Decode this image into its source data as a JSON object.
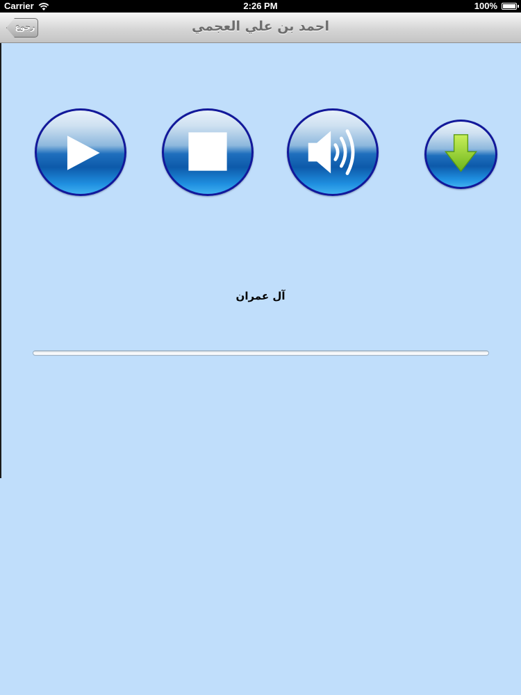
{
  "status_bar": {
    "carrier": "Carrier",
    "time": "2:26 PM",
    "battery": "100%",
    "battery_level": 1.0
  },
  "nav": {
    "back_label": "رجوع",
    "title": "احمد بن علي العجمي"
  },
  "controls": {
    "play": "play-icon",
    "stop": "stop-icon",
    "volume": "speaker-icon",
    "download": "download-arrow-icon"
  },
  "player": {
    "surah_name": "آل عمران",
    "progress": 0.0
  }
}
